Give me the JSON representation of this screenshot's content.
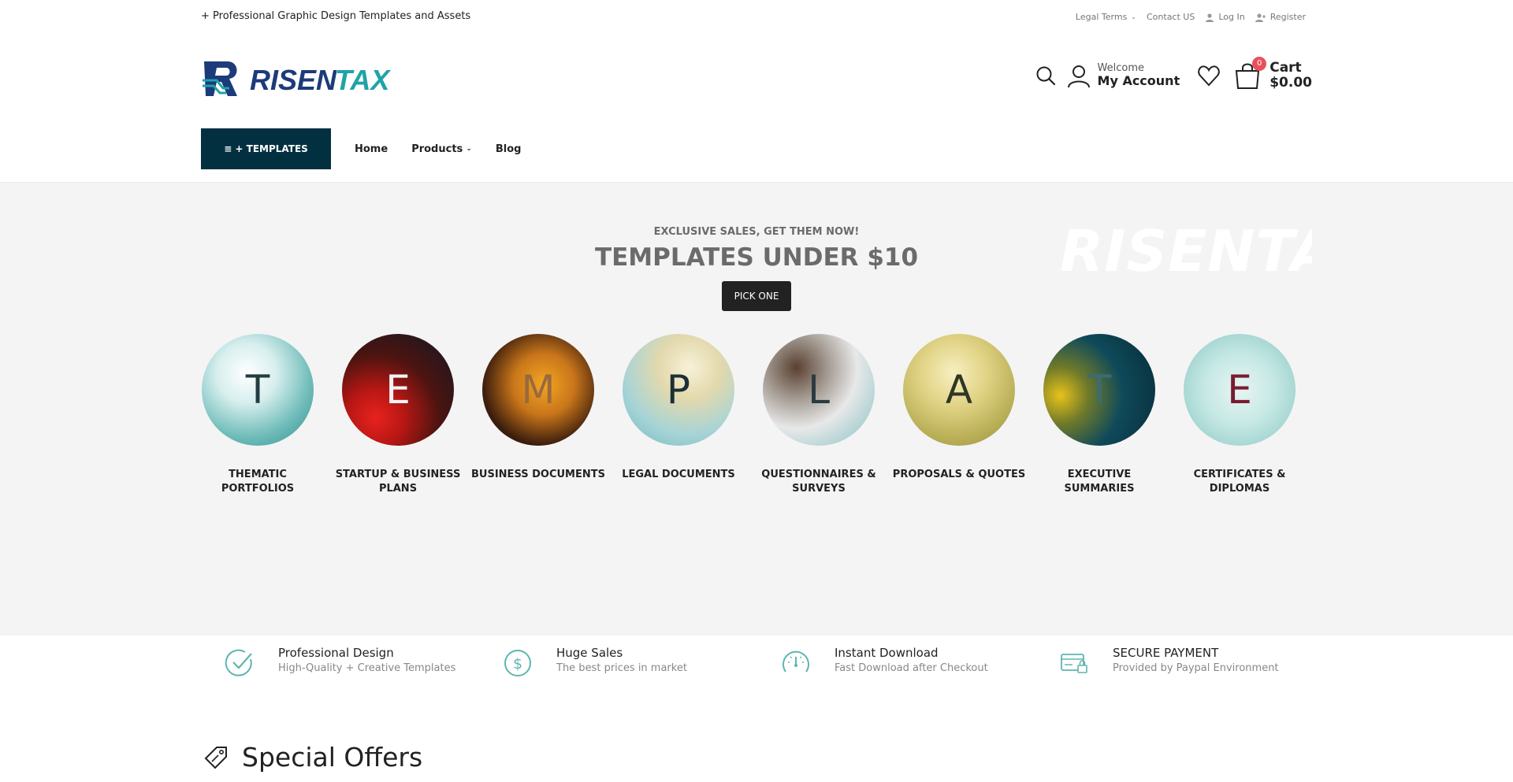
{
  "topbar": {
    "tagline": "+ Professional Graphic Design Templates and Assets",
    "links": {
      "legal": "Legal Terms",
      "contact": "Contact US",
      "login": "Log In",
      "register": "Register"
    }
  },
  "header": {
    "logo_text": "RISENTAX",
    "account": {
      "welcome": "Welcome",
      "label": "My Account"
    },
    "cart": {
      "label": "Cart",
      "amount": "$0.00",
      "count": "0"
    }
  },
  "nav": {
    "templates_button": "≡ + TEMPLATES",
    "links": {
      "home": "Home",
      "products": "Products",
      "blog": "Blog"
    }
  },
  "banner": {
    "subtitle": "EXCLUSIVE SALES, GET THEM NOW!",
    "title": "TEMPLATES UNDER $10",
    "button": "PICK ONE",
    "watermark": "RISENTAX",
    "categories": [
      {
        "letter": "T",
        "label": "THEMATIC PORTFOLIOS"
      },
      {
        "letter": "E",
        "label": "STARTUP & BUSINESS PLANS"
      },
      {
        "letter": "M",
        "label": "BUSINESS DOCUMENTS"
      },
      {
        "letter": "P",
        "label": "LEGAL DOCUMENTS"
      },
      {
        "letter": "L",
        "label": "QUESTIONNAIRES & SURVEYS"
      },
      {
        "letter": "A",
        "label": "PROPOSALS & QUOTES"
      },
      {
        "letter": "T",
        "label": "EXECUTIVE SUMMARIES"
      },
      {
        "letter": "E",
        "label": "CERTIFICATES & DIPLOMAS"
      }
    ]
  },
  "features": [
    {
      "title": "Professional Design",
      "desc": "High-Quality + Creative Templates",
      "icon": "check-circle-icon"
    },
    {
      "title": "Huge Sales",
      "desc": "The best prices in market",
      "icon": "dollar-circle-icon"
    },
    {
      "title": "Instant Download",
      "desc": "Fast Download after Checkout",
      "icon": "speedometer-icon"
    },
    {
      "title": "SECURE PAYMENT",
      "desc": "Provided by Paypal Environment",
      "icon": "secure-card-icon"
    }
  ],
  "offers": {
    "title": "Special Offers"
  },
  "colors": {
    "nav_button": "#023041",
    "logo_navy": "#1c3b7a",
    "logo_teal": "#20a3a8",
    "badge": "#e8505b",
    "icon_teal": "#5fb5b0"
  }
}
